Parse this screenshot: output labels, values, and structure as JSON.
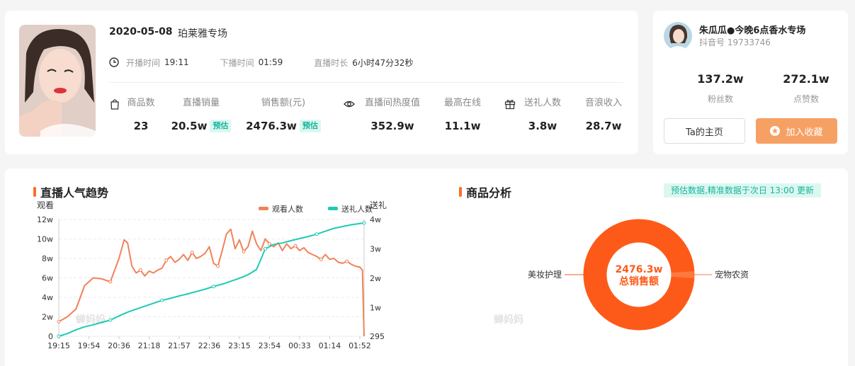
{
  "live": {
    "date": "2020-05-08",
    "name": "珀莱雅专场",
    "start_label": "开播时间",
    "start_value": "19:11",
    "end_label": "下播时间",
    "end_value": "01:59",
    "duration_label": "直播时长",
    "duration_value": "6小时47分32秒",
    "estimate_badge": "预估",
    "stats": {
      "goods_label": "商品数",
      "goods_value": "23",
      "sales_label": "直播销量",
      "sales_value": "20.5w",
      "revenue_label": "销售额(元)",
      "revenue_value": "2476.3w",
      "heat_label": "直播间热度值",
      "heat_value": "352.9w",
      "peak_label": "最高在线",
      "peak_value": "11.1w",
      "gifters_label": "送礼人数",
      "gifters_value": "3.8w",
      "income_label": "音浪收入",
      "income_value": "28.7w"
    }
  },
  "profile": {
    "name": "朱瓜瓜●今晚6点香水专场",
    "douyin_id": "抖音号 19733746",
    "fans_value": "137.2w",
    "fans_label": "粉丝数",
    "likes_value": "272.1w",
    "likes_label": "点赞数",
    "home_button": "Ta的主页",
    "fav_button": "加入收藏"
  },
  "trend": {
    "title": "直播人气趋势",
    "watermark": "蝉妈妈"
  },
  "analysis": {
    "title": "商品分析",
    "note": "预估数据,精准数据于次日 13:00 更新",
    "watermark": "蝉妈妈"
  },
  "colors": {
    "accent": "#ff6b2c",
    "viewers": "#f0825a",
    "gifts": "#1fcab3",
    "donut": "#fd5a1a",
    "fav_button": "#f7a064"
  },
  "chart_data": [
    {
      "type": "line",
      "x": [
        "19:15",
        "19:54",
        "20:36",
        "21:18",
        "21:57",
        "22:36",
        "23:15",
        "23:54",
        "00:33",
        "01:14",
        "01:52"
      ],
      "left_axis_label": "观看",
      "right_axis_label": "送礼",
      "left_ticks": [
        "0",
        "2w",
        "4w",
        "6w",
        "8w",
        "10w",
        "12w"
      ],
      "right_ticks": [
        "295",
        "1w",
        "2w",
        "3w",
        "4w"
      ],
      "ylim_left": [
        0,
        120000
      ],
      "ylim_right": [
        295,
        40000
      ],
      "grid": true,
      "legend_position": "top-right",
      "series": [
        {
          "name": "观看人数",
          "axis": "left",
          "values": [
            [
              0,
              15000
            ],
            [
              1,
              20000
            ],
            [
              2,
              28000
            ],
            [
              3,
              52000
            ],
            [
              4,
              60000
            ],
            [
              5,
              59000
            ],
            [
              6,
              56000
            ],
            [
              7,
              80000
            ],
            [
              7.6,
              99000
            ],
            [
              8,
              96000
            ],
            [
              8.5,
              72000
            ],
            [
              9,
              65000
            ],
            [
              9.5,
              68000
            ],
            [
              10,
              62000
            ],
            [
              10.5,
              67000
            ],
            [
              11,
              65000
            ],
            [
              11.5,
              68000
            ],
            [
              12,
              70000
            ],
            [
              12.5,
              78000
            ],
            [
              13,
              82000
            ],
            [
              13.5,
              76000
            ],
            [
              14,
              79000
            ],
            [
              14.5,
              84000
            ],
            [
              15,
              78000
            ],
            [
              15.5,
              86000
            ],
            [
              16,
              80000
            ],
            [
              16.5,
              82000
            ],
            [
              17,
              85000
            ],
            [
              17.5,
              92000
            ],
            [
              18,
              75000
            ],
            [
              18.5,
              72000
            ],
            [
              19,
              88000
            ],
            [
              19.5,
              105000
            ],
            [
              20,
              110000
            ],
            [
              20.5,
              90000
            ],
            [
              21,
              99000
            ],
            [
              21.5,
              87000
            ],
            [
              22,
              92000
            ],
            [
              22.5,
              108000
            ],
            [
              23,
              95000
            ],
            [
              23.5,
              88000
            ],
            [
              24,
              100000
            ],
            [
              24.5,
              95000
            ],
            [
              25,
              92000
            ],
            [
              25.5,
              96000
            ],
            [
              26,
              88000
            ],
            [
              26.5,
              95000
            ],
            [
              27,
              90000
            ],
            [
              27.5,
              93000
            ],
            [
              28,
              88000
            ],
            [
              28.5,
              91000
            ],
            [
              29,
              86000
            ],
            [
              29.5,
              84000
            ],
            [
              30,
              82000
            ],
            [
              30.5,
              79000
            ],
            [
              31,
              84000
            ],
            [
              31.5,
              79000
            ],
            [
              32,
              80000
            ],
            [
              32.5,
              76000
            ],
            [
              33,
              75000
            ],
            [
              33.5,
              77000
            ],
            [
              34,
              74000
            ],
            [
              34.5,
              72000
            ],
            [
              35,
              71000
            ],
            [
              35.3,
              68000
            ],
            [
              35.5,
              0
            ]
          ]
        },
        {
          "name": "送礼人数",
          "axis": "right",
          "values": [
            [
              0,
              295
            ],
            [
              1,
              1200
            ],
            [
              2,
              2500
            ],
            [
              3,
              3500
            ],
            [
              4,
              4200
            ],
            [
              5,
              5000
            ],
            [
              6,
              5800
            ],
            [
              7,
              7200
            ],
            [
              8,
              8500
            ],
            [
              9,
              9500
            ],
            [
              10,
              10500
            ],
            [
              11,
              11500
            ],
            [
              12,
              12500
            ],
            [
              13,
              13200
            ],
            [
              14,
              14000
            ],
            [
              15,
              14700
            ],
            [
              16,
              15500
            ],
            [
              17,
              16300
            ],
            [
              18,
              17200
            ],
            [
              19,
              18000
            ],
            [
              20,
              19000
            ],
            [
              21,
              20000
            ],
            [
              22,
              21200
            ],
            [
              23,
              23000
            ],
            [
              24,
              30000
            ],
            [
              25,
              31500
            ],
            [
              26,
              32000
            ],
            [
              27,
              32800
            ],
            [
              28,
              33500
            ],
            [
              29,
              34200
            ],
            [
              30,
              35000
            ],
            [
              31,
              36000
            ],
            [
              32,
              37000
            ],
            [
              33,
              37600
            ],
            [
              34,
              38200
            ],
            [
              35,
              38600
            ],
            [
              35.5,
              38800
            ]
          ]
        }
      ]
    },
    {
      "type": "pie",
      "labels": [
        "美妆护理",
        "宠物农资"
      ],
      "values": [
        0.98,
        0.02
      ],
      "center_value": "2476.3w",
      "center_label": "总销售额"
    }
  ]
}
